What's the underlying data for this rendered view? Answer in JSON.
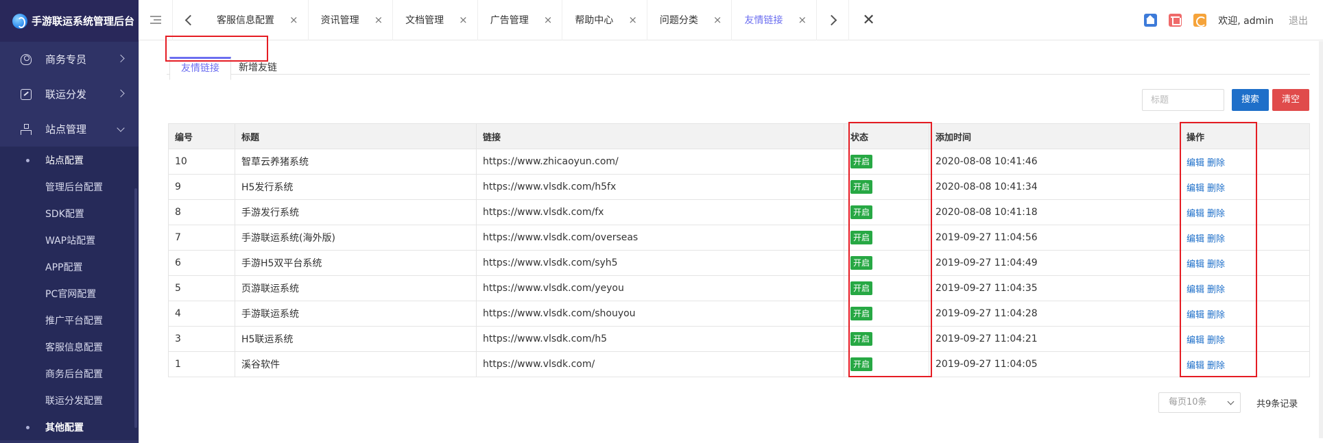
{
  "brand": {
    "title": "手游联运系统管理后台"
  },
  "sidebar": {
    "items": [
      {
        "label": "商务专员",
        "icon": "user-icon"
      },
      {
        "label": "联运分发",
        "icon": "share-icon"
      },
      {
        "label": "站点管理",
        "icon": "sitemap-icon"
      }
    ],
    "submenu": [
      "站点配置",
      "管理后台配置",
      "SDK配置",
      "WAP站配置",
      "APP配置",
      "PC官网配置",
      "推广平台配置",
      "客服信息配置",
      "商务后台配置",
      "联运分发配置",
      "其他配置"
    ]
  },
  "topbar": {
    "tabs": [
      {
        "label": "客服信息配置"
      },
      {
        "label": "资讯管理"
      },
      {
        "label": "文档管理"
      },
      {
        "label": "广告管理"
      },
      {
        "label": "帮助中心"
      },
      {
        "label": "问题分类"
      },
      {
        "label": "友情链接"
      }
    ],
    "tab_close": "×",
    "close_all": "✕",
    "welcome": "欢迎, admin",
    "logout": "退出"
  },
  "subtabs": {
    "list": "友情链接",
    "add": "新增友链"
  },
  "search": {
    "placeholder": "标题",
    "search_label": "搜索",
    "clear_label": "清空"
  },
  "table": {
    "headers": {
      "id": "编号",
      "title": "标题",
      "link": "链接",
      "status": "状态",
      "time": "添加时间",
      "ops": "操作"
    },
    "rows": [
      {
        "id": "10",
        "title": "智草云养猪系统",
        "link": "https://www.zhicaoyun.com/",
        "status": "开启",
        "time": "2020-08-08 10:41:46",
        "edit": "编辑",
        "del": "删除"
      },
      {
        "id": "9",
        "title": "H5发行系统",
        "link": "https://www.vlsdk.com/h5fx",
        "status": "开启",
        "time": "2020-08-08 10:41:34",
        "edit": "编辑",
        "del": "删除"
      },
      {
        "id": "8",
        "title": "手游发行系统",
        "link": "https://www.vlsdk.com/fx",
        "status": "开启",
        "time": "2020-08-08 10:41:18",
        "edit": "编辑",
        "del": "删除"
      },
      {
        "id": "7",
        "title": "手游联运系统(海外版)",
        "link": "https://www.vlsdk.com/overseas",
        "status": "开启",
        "time": "2019-09-27 11:04:56",
        "edit": "编辑",
        "del": "删除"
      },
      {
        "id": "6",
        "title": "手游H5双平台系统",
        "link": "https://www.vlsdk.com/syh5",
        "status": "开启",
        "time": "2019-09-27 11:04:49",
        "edit": "编辑",
        "del": "删除"
      },
      {
        "id": "5",
        "title": "页游联运系统",
        "link": "https://www.vlsdk.com/yeyou",
        "status": "开启",
        "time": "2019-09-27 11:04:35",
        "edit": "编辑",
        "del": "删除"
      },
      {
        "id": "4",
        "title": "手游联运系统",
        "link": "https://www.vlsdk.com/shouyou",
        "status": "开启",
        "time": "2019-09-27 11:04:28",
        "edit": "编辑",
        "del": "删除"
      },
      {
        "id": "3",
        "title": "H5联运系统",
        "link": "https://www.vlsdk.com/h5",
        "status": "开启",
        "time": "2019-09-27 11:04:21",
        "edit": "编辑",
        "del": "删除"
      },
      {
        "id": "1",
        "title": "溪谷软件",
        "link": "https://www.vlsdk.com/",
        "status": "开启",
        "time": "2019-09-27 11:04:05",
        "edit": "编辑",
        "del": "删除"
      }
    ]
  },
  "pager": {
    "per_page": "每页10条",
    "total": "共9条记录"
  },
  "colors": {
    "accent": "#6b6ef0",
    "sidebar": "#2f3366",
    "success": "#27a844",
    "primary": "#1e6fc9",
    "danger": "#e04b4b",
    "highlight": "#e51c23"
  }
}
